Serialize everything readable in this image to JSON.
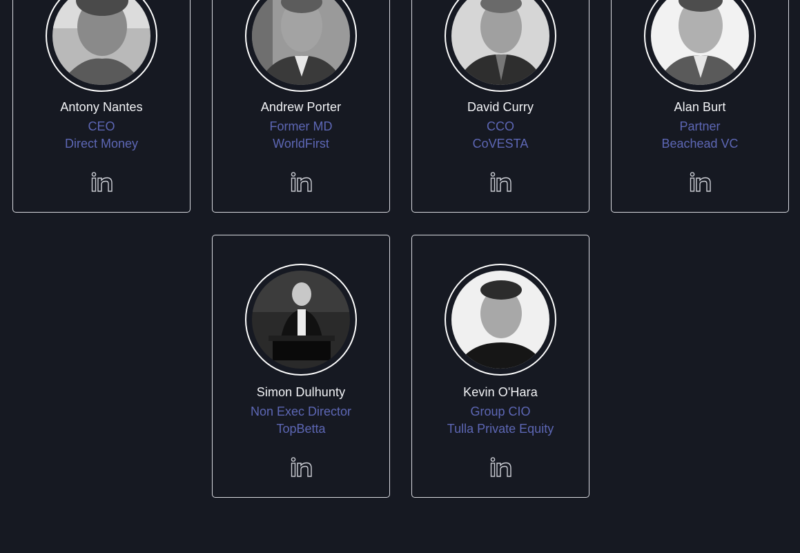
{
  "team": [
    {
      "name": "Antony Nantes",
      "role": "CEO",
      "company": "Direct Money",
      "icon": "linkedin-icon"
    },
    {
      "name": "Andrew Porter",
      "role": "Former MD",
      "company": "WorldFirst",
      "icon": "linkedin-icon"
    },
    {
      "name": "David Curry",
      "role": "CCO",
      "company": "CoVESTA",
      "icon": "linkedin-icon"
    },
    {
      "name": "Alan Burt",
      "role": "Partner",
      "company": "Beachead VC",
      "icon": "linkedin-icon"
    },
    {
      "name": "Simon Dulhunty",
      "role": "Non Exec Director",
      "company": "TopBetta",
      "icon": "linkedin-icon"
    },
    {
      "name": "Kevin O'Hara",
      "role": "Group CIO",
      "company": "Tulla Private Equity",
      "icon": "linkedin-icon"
    }
  ],
  "colors": {
    "background": "#161922",
    "card_border": "#d9dbe1",
    "name_text": "#f3f4f7",
    "accent_text": "#5d67b5"
  }
}
